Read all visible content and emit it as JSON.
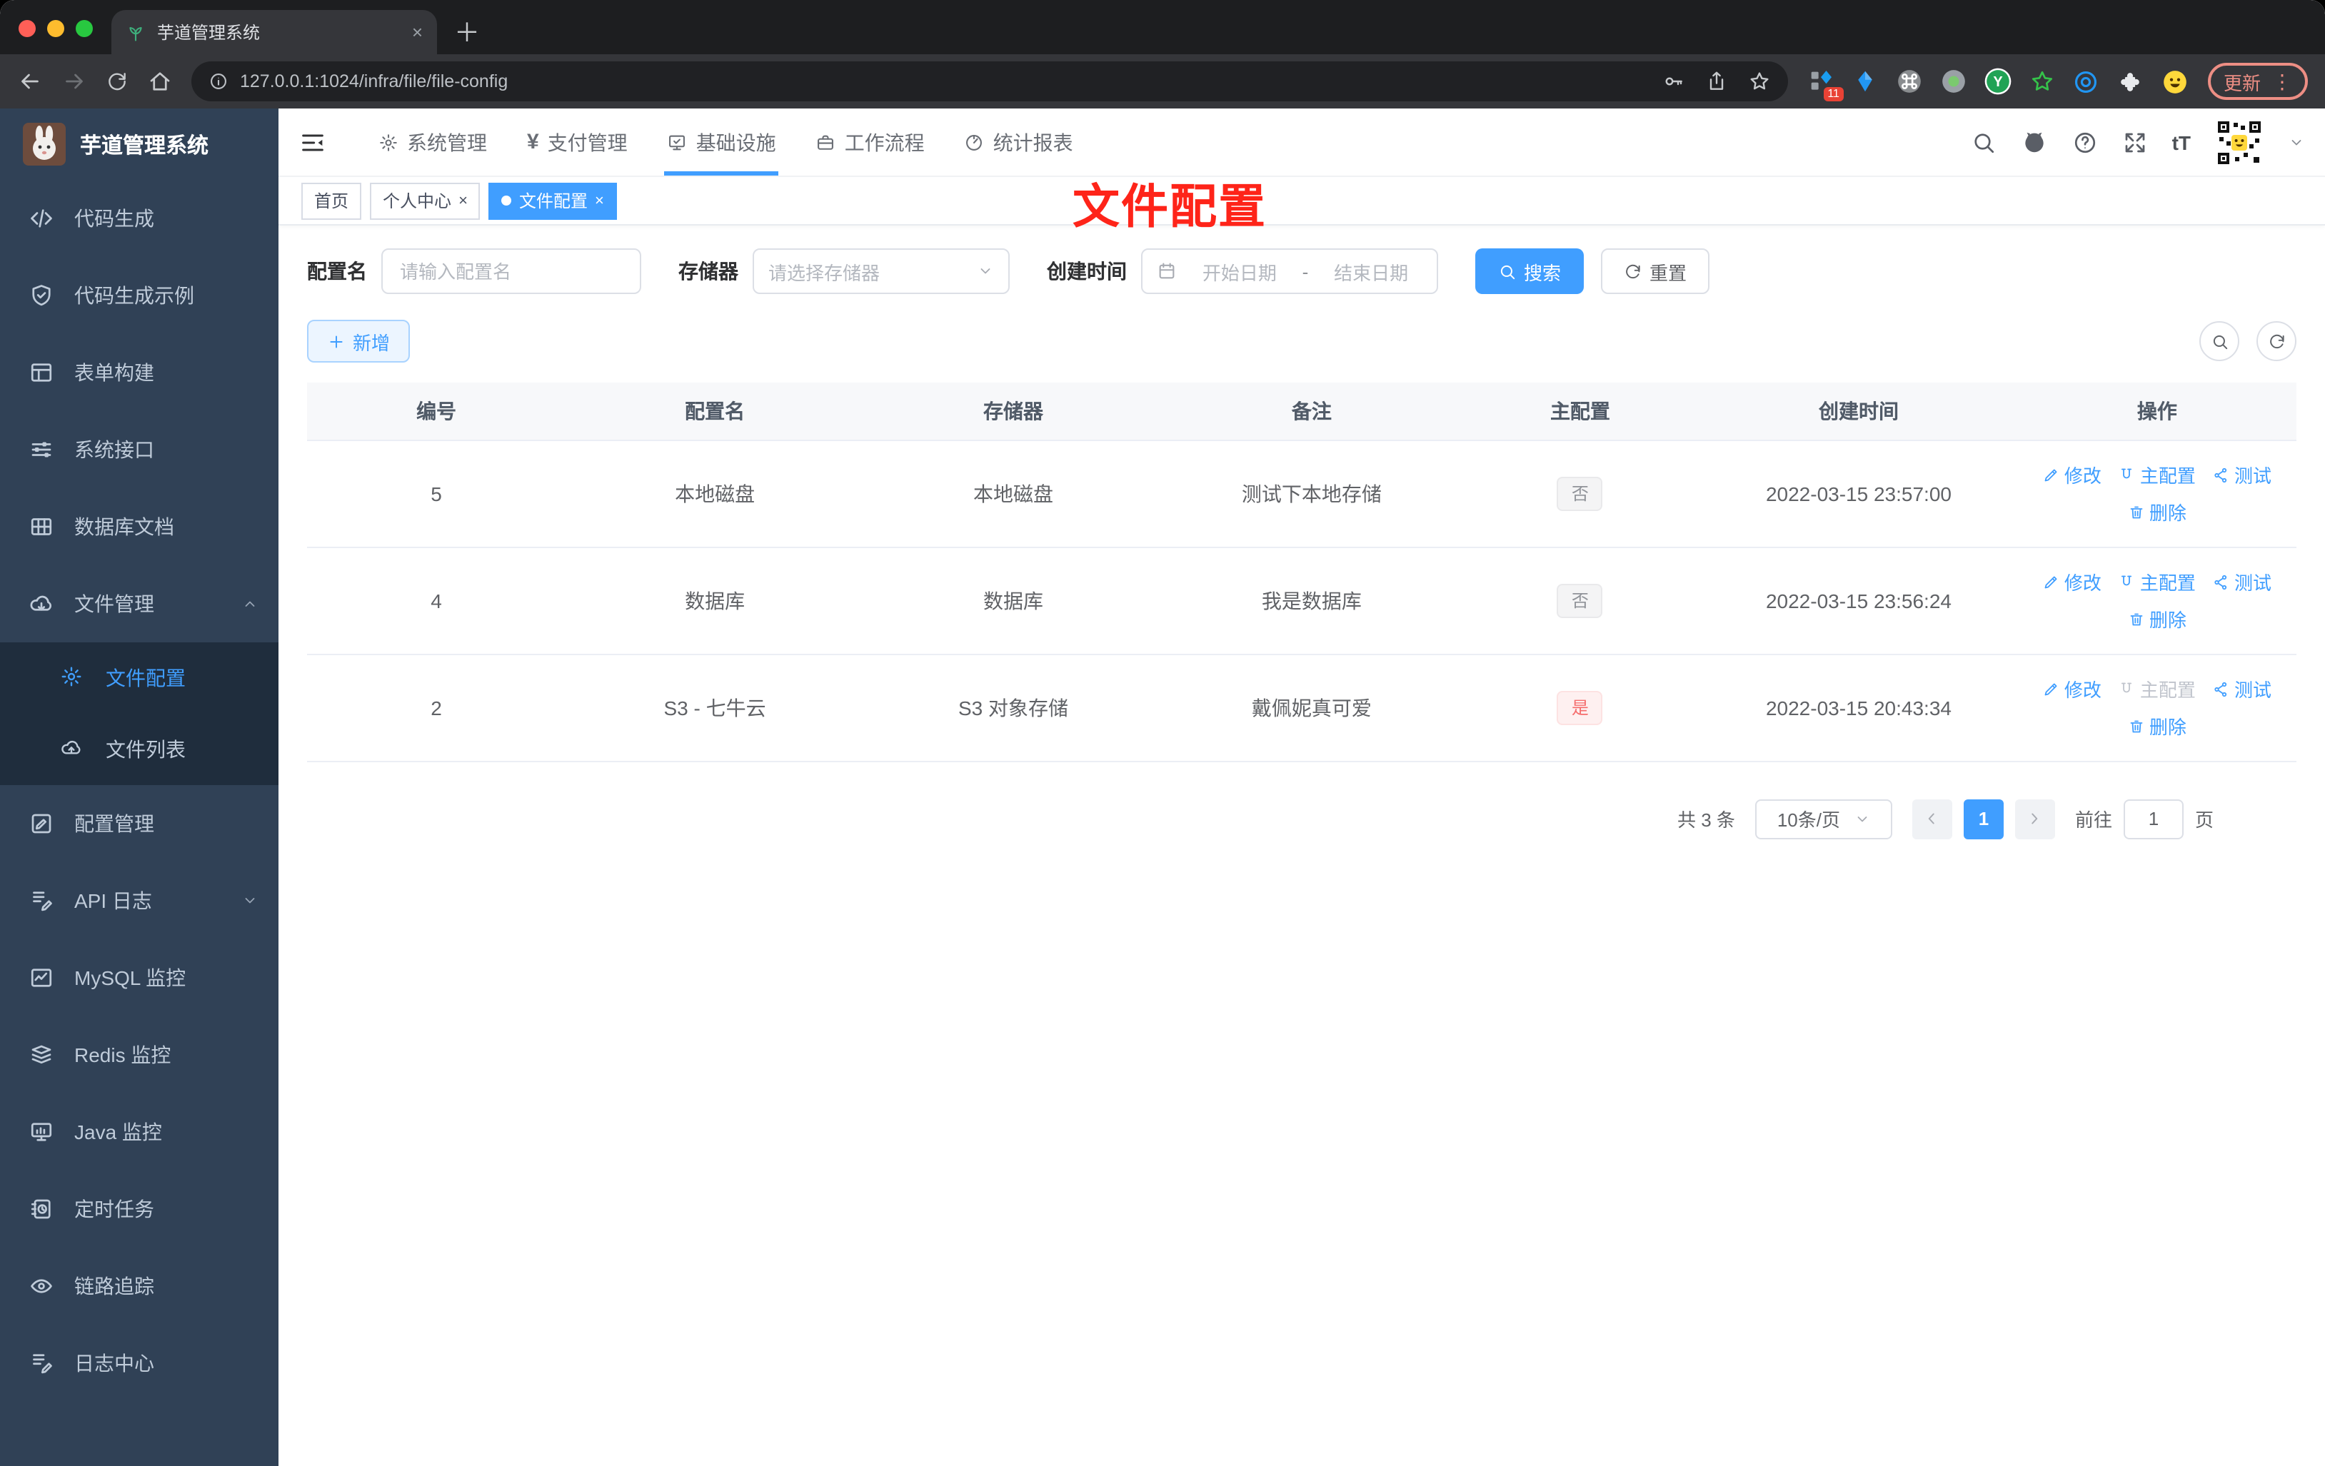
{
  "browser": {
    "tab_title": "芋道管理系统",
    "url": "127.0.0.1:1024/infra/file/file-config",
    "update_label": "更新",
    "extension_badge": "11"
  },
  "glyphs": {
    "close": "×",
    "plus": "＋",
    "dots": "⋮",
    "yen": "¥",
    "font_size": "tT"
  },
  "header": {
    "menus": [
      "系统管理",
      "支付管理",
      "基础设施",
      "工作流程",
      "统计报表"
    ]
  },
  "sidebar": {
    "title": "芋道管理系统",
    "items": [
      "代码生成",
      "代码生成示例",
      "表单构建",
      "系统接口",
      "数据库文档",
      "文件管理",
      "文件配置",
      "文件列表",
      "配置管理",
      "API 日志",
      "MySQL 监控",
      "Redis 监控",
      "Java 监控",
      "定时任务",
      "链路追踪",
      "日志中心"
    ]
  },
  "tags": {
    "home": "首页",
    "profile": "个人中心",
    "file_config": "文件配置"
  },
  "annotation": {
    "text": "文件配置",
    "color": "#fe2419"
  },
  "filters": {
    "name_label": "配置名",
    "name_placeholder": "请输入配置名",
    "storage_label": "存储器",
    "storage_placeholder": "请选择存储器",
    "time_label": "创建时间",
    "start_placeholder": "开始日期",
    "separator": "-",
    "end_placeholder": "结束日期",
    "search": "搜索",
    "reset": "重置"
  },
  "toolbar": {
    "add": "新增"
  },
  "table": {
    "columns": [
      "编号",
      "配置名",
      "存储器",
      "备注",
      "主配置",
      "创建时间",
      "操作"
    ],
    "rows": [
      {
        "id": "5",
        "name": "本地磁盘",
        "storage": "本地磁盘",
        "remark": "测试下本地存储",
        "master": "否",
        "time": "2022-03-15 23:57:00"
      },
      {
        "id": "4",
        "name": "数据库",
        "storage": "数据库",
        "remark": "我是数据库",
        "master": "否",
        "time": "2022-03-15 23:56:24"
      },
      {
        "id": "2",
        "name": "S3 - 七牛云",
        "storage": "S3 对象存储",
        "remark": "戴佩妮真可爱",
        "master": "是",
        "time": "2022-03-15 20:43:34"
      }
    ],
    "actions": {
      "edit": "修改",
      "master": "主配置",
      "test": "测试",
      "delete": "删除"
    }
  },
  "pagination": {
    "total": "共 3 条",
    "size": "10条/页",
    "page": "1",
    "goto": "前往",
    "goto_value": "1",
    "unit": "页"
  },
  "colors": {
    "primary": "#409eff",
    "sidebar_bg": "#304156",
    "submenu_bg": "#1f2d3d",
    "danger": "#f56c6c"
  }
}
